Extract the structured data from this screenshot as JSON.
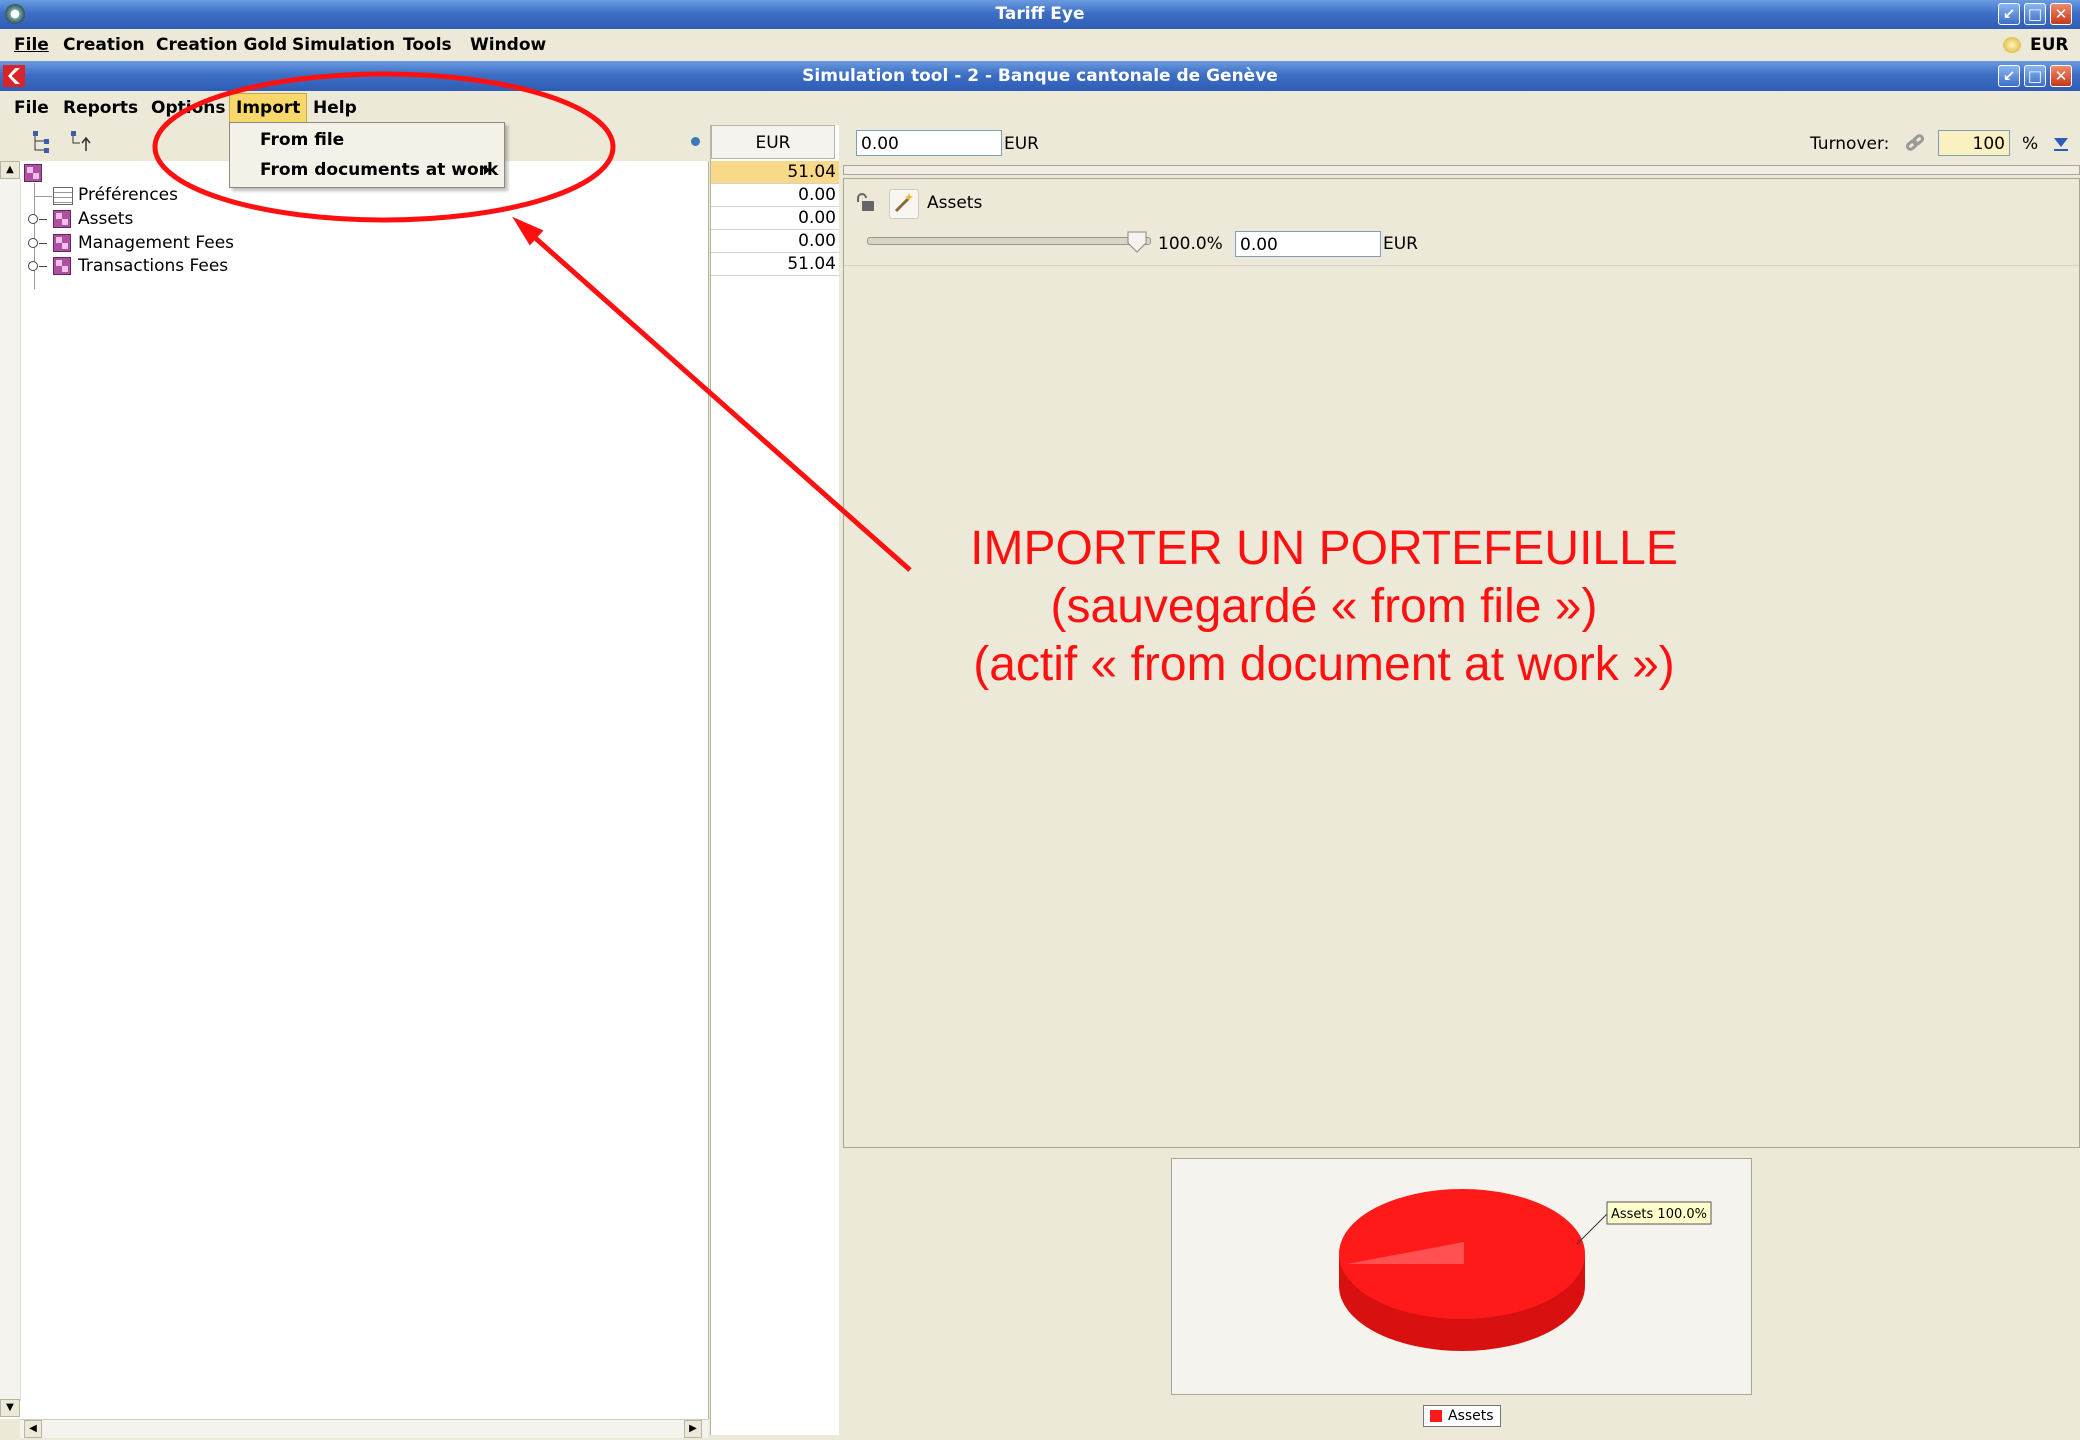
{
  "app": {
    "title": "Tariff Eye",
    "currency_indicator": "EUR",
    "menu": [
      "File",
      "Creation",
      "Creation Gold",
      "Simulation",
      "Tools",
      "Window"
    ]
  },
  "inner_window": {
    "title": "Simulation tool - 2 - Banque cantonale de Genève",
    "menu": [
      "File",
      "Reports",
      "Options",
      "Import",
      "Help"
    ],
    "active_menu": "Import",
    "import_dropdown": {
      "items": [
        {
          "label": "From file"
        },
        {
          "label": "From documents at work",
          "has_submenu": true
        }
      ]
    }
  },
  "tree": {
    "items": [
      {
        "label": "Préférences",
        "icon": "preferences-icon"
      },
      {
        "label": "Assets",
        "icon": "fee-group-icon"
      },
      {
        "label": "Management Fees",
        "icon": "fee-group-icon"
      },
      {
        "label": "Transactions Fees",
        "icon": "fee-group-icon"
      }
    ]
  },
  "values_column": {
    "header": "EUR",
    "rows": [
      "51.04",
      "0.00",
      "0.00",
      "0.00",
      "51.04"
    ]
  },
  "detail": {
    "amount_value": "0.00",
    "amount_currency": "EUR",
    "turnover_label": "Turnover:",
    "turnover_value": "100",
    "turnover_unit": "%",
    "assets_label": "Assets",
    "slider_percent": "100.0%",
    "slider_fraction": 1.0,
    "assets_amount": "0.00",
    "assets_currency": "EUR"
  },
  "chart_data": {
    "type": "pie",
    "categories": [
      "Assets"
    ],
    "values": [
      100.0
    ],
    "slice_labels": [
      "Assets 100.0%"
    ],
    "legend": [
      "Assets"
    ],
    "colors": [
      "#ff1a1a"
    ]
  },
  "annotation": {
    "lines": [
      "IMPORTER UN PORTEFEUILLE",
      "(sauvegardé « from file »)",
      "(actif « from document at work »)"
    ],
    "color": "#ff1010"
  }
}
